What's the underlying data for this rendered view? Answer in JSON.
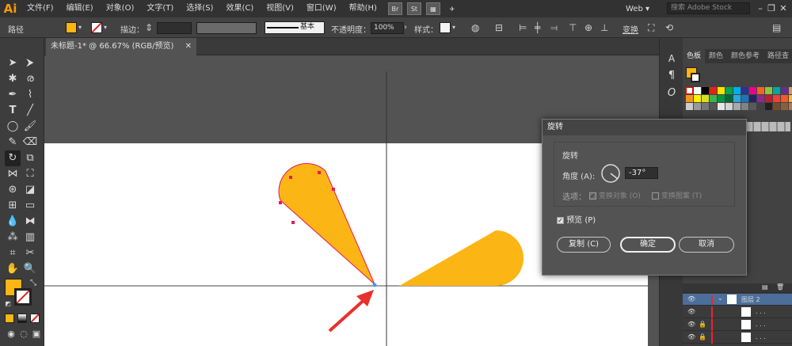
{
  "app": {
    "logo": "Ai"
  },
  "menu": [
    "文件(F)",
    "编辑(E)",
    "对象(O)",
    "文字(T)",
    "选择(S)",
    "效果(C)",
    "视图(V)",
    "窗口(W)",
    "帮助(H)"
  ],
  "menubar_buttons": [
    "Br",
    "St"
  ],
  "workspace": "Web ▾",
  "stock_search_placeholder": "搜索 Adobe Stock",
  "control": {
    "mode_label": "路径",
    "stroke_label": "描边：",
    "stroke_profile": "基本",
    "opacity_label": "不透明度：",
    "opacity_value": "100%",
    "style_label": "样式：",
    "transform_label": "变换"
  },
  "document_tab": "未标题-1* @ 66.67% (RGB/预览)",
  "right_panel": {
    "tabs": [
      "色板",
      "颜色",
      "颜色参考",
      "路径查"
    ],
    "layer_name": "图层 2",
    "sublayer_label": ". . ."
  },
  "dialog": {
    "title": "旋转",
    "group_label": "旋转",
    "angle_label": "角度 (A):",
    "angle_value": "-37°",
    "options_label": "选项：",
    "opt_objects": "变换对象 (O)",
    "opt_patterns": "变换图案 (T)",
    "preview_label": "预览 (P)",
    "copy_button": "复制 (C)",
    "ok_button": "确定",
    "cancel_button": "取消"
  },
  "colors": {
    "fill": "#fbb514",
    "selection": "#e8175d",
    "arrow": "#e8302a"
  }
}
